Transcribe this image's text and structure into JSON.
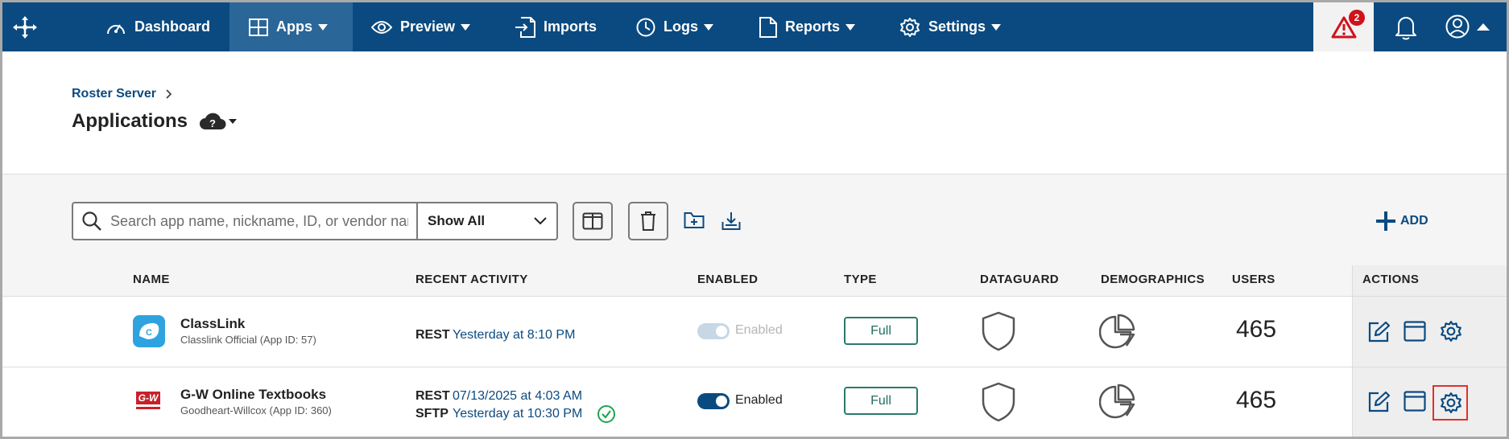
{
  "nav": {
    "items": [
      {
        "label": "Dashboard",
        "icon": "dashboard-gauge-icon"
      },
      {
        "label": "Apps",
        "icon": "apps-grid-icon"
      },
      {
        "label": "Preview",
        "icon": "eye-icon"
      },
      {
        "label": "Imports",
        "icon": "import-file-icon"
      },
      {
        "label": "Logs",
        "icon": "clock-icon"
      },
      {
        "label": "Reports",
        "icon": "document-icon"
      },
      {
        "label": "Settings",
        "icon": "gear-icon"
      }
    ],
    "alert_count": "2",
    "colors": {
      "bar": "#0b4a80",
      "active": "#2a6698",
      "alert": "#d0121b"
    }
  },
  "breadcrumb": {
    "parent": "Roster Server"
  },
  "page": {
    "title": "Applications"
  },
  "toolbar": {
    "search_placeholder": "Search app name, nickname, ID, or vendor name",
    "filter_value": "Show All",
    "add_label": "ADD"
  },
  "table": {
    "headers": {
      "name": "NAME",
      "recent_activity": "RECENT ACTIVITY",
      "enabled": "ENABLED",
      "type": "TYPE",
      "dataguard": "DATAGUARD",
      "demographics": "DEMOGRAPHICS",
      "users": "USERS",
      "actions": "ACTIONS"
    },
    "rows": [
      {
        "name": "ClassLink",
        "subtitle": "Classlink Official (App ID: 57)",
        "activity": [
          {
            "label": "REST",
            "value": "Yesterday at 8:10 PM"
          }
        ],
        "enabled_label": "Enabled",
        "enabled": false,
        "type": "Full",
        "users": "465"
      },
      {
        "name": "G-W Online Textbooks",
        "subtitle": "Goodheart-Willcox (App ID: 360)",
        "activity": [
          {
            "label": "REST",
            "value": "07/13/2025 at 4:03 AM"
          },
          {
            "label": "SFTP",
            "value": "Yesterday at 10:30 PM"
          }
        ],
        "enabled_label": "Enabled",
        "enabled": true,
        "type": "Full",
        "users": "465",
        "logo_text": "G-W"
      }
    ]
  }
}
